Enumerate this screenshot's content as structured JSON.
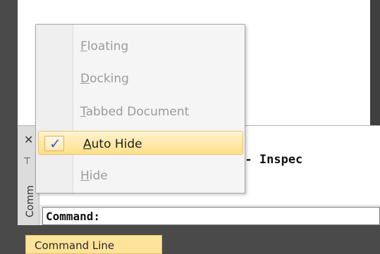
{
  "command_palette": {
    "title": "Comm",
    "history_text": "RTIES - Inspec",
    "input_label": "Command:"
  },
  "context_menu": {
    "items": [
      {
        "label": "Floating",
        "underline": "F",
        "rest": "loating",
        "state": "disabled"
      },
      {
        "label": "Docking",
        "underline": "D",
        "rest": "ocking",
        "state": "disabled"
      },
      {
        "label": "Tabbed Document",
        "underline": "T",
        "rest": "abbed Document",
        "state": "disabled"
      },
      {
        "label": "Auto Hide",
        "underline": "A",
        "rest": "uto Hide",
        "state": "checked"
      },
      {
        "label": "Hide",
        "underline": "H",
        "rest": "ide",
        "state": "disabled"
      }
    ]
  },
  "status_tab": {
    "label": "Command Line"
  },
  "icons": {
    "close": "close-icon",
    "pin": "pin-icon",
    "check": "check-icon"
  },
  "colors": {
    "accent_highlight": "#ffe08a",
    "check_color": "#2b66c7",
    "disabled_text": "#9b9b9b"
  }
}
